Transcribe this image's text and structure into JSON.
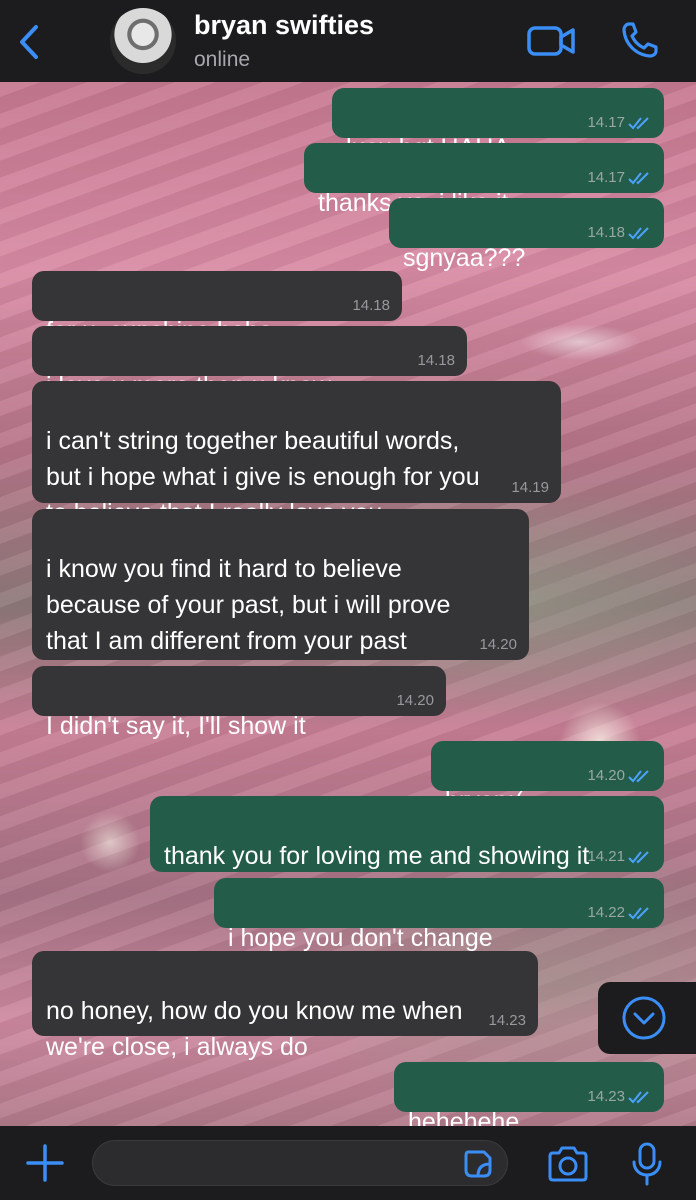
{
  "header": {
    "contact_name": "bryan swifties",
    "status": "online"
  },
  "colors": {
    "accent": "#3a8ef6",
    "outgoing_bubble": "#245c4a",
    "incoming_bubble": "#353537",
    "bar_background": "#1c1c1e"
  },
  "messages": [
    {
      "direction": "out",
      "text": "lucu bgt HAHA",
      "time": "14.17",
      "read": true
    },
    {
      "direction": "out",
      "text": "thanks ya, i like it",
      "time": "14.17",
      "read": true
    },
    {
      "direction": "out",
      "text": "sgnyaa???",
      "time": "14.18",
      "read": true
    },
    {
      "direction": "in",
      "text": "for u, sunshine hehe",
      "time": "14.18"
    },
    {
      "direction": "in",
      "text": "i love u more than u know",
      "time": "14.18"
    },
    {
      "direction": "in",
      "text": "i can't string together beautiful words,\nbut i hope what i give is enough for you\nto believe that I really love you",
      "time": "14.19"
    },
    {
      "direction": "in",
      "text": "i know you find it hard to believe\nbecause of your past, but i will prove\nthat I am different from your past",
      "time": "14.20"
    },
    {
      "direction": "in",
      "text": "I didn't say it, I'll show it",
      "time": "14.20"
    },
    {
      "direction": "out",
      "text": "bryan:(",
      "time": "14.20",
      "read": true
    },
    {
      "direction": "out",
      "text": "thank you for loving me and showing it",
      "time": "14.21",
      "read": true
    },
    {
      "direction": "out",
      "text": "i hope you don't change",
      "time": "14.22",
      "read": true
    },
    {
      "direction": "in",
      "text": "no honey, how do you know me when\nwe're close, i always do",
      "time": "14.23"
    },
    {
      "direction": "out",
      "text": "hehehehe",
      "time": "14.23",
      "read": true
    }
  ],
  "composer": {
    "value": "",
    "placeholder": ""
  },
  "icons": {
    "back": "chevron-left",
    "video_call": "video-camera",
    "voice_call": "phone",
    "attach": "plus",
    "sticker": "sticker",
    "camera": "camera",
    "microphone": "microphone",
    "scroll_down": "chevron-down-circle"
  }
}
